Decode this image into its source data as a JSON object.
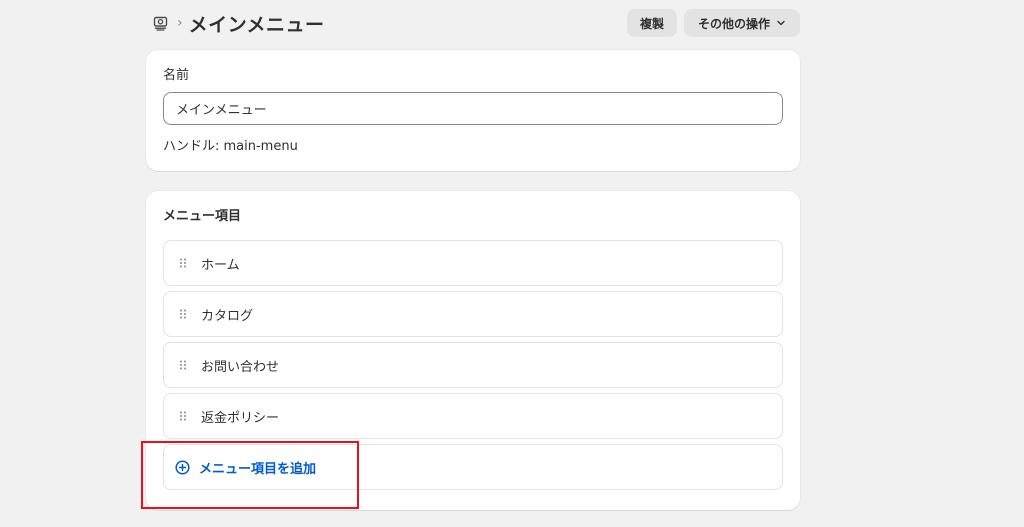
{
  "header": {
    "nav_icon": "navigation-icon",
    "separator": "›",
    "title": "メインメニュー",
    "duplicate_label": "複製",
    "more_actions_label": "その他の操作"
  },
  "name_card": {
    "label": "名前",
    "value": "メインメニュー",
    "handle_text": "ハンドル: main-menu"
  },
  "items_card": {
    "title": "メニュー項目",
    "items": [
      {
        "label": "ホーム"
      },
      {
        "label": "カタログ"
      },
      {
        "label": "お問い合わせ"
      },
      {
        "label": "返金ポリシー"
      }
    ],
    "add_label": "メニュー項目を追加"
  },
  "colors": {
    "background": "#f1f1f1",
    "card": "#ffffff",
    "link": "#005bd3",
    "highlight": "#e8101a"
  }
}
